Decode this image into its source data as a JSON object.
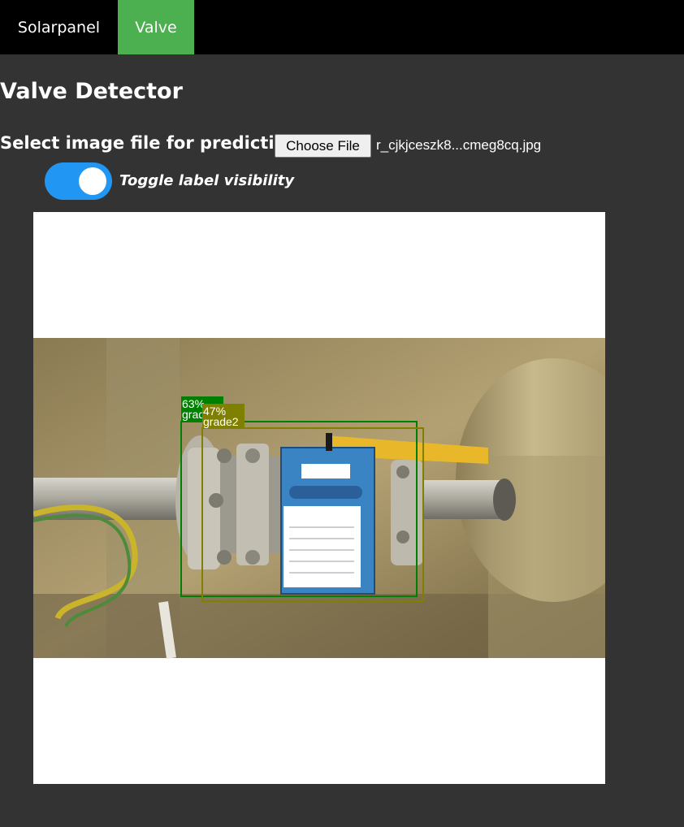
{
  "nav": {
    "tabs": [
      {
        "label": "Solarpanel",
        "active": false
      },
      {
        "label": "Valve",
        "active": true
      }
    ],
    "active_color": "#4caf50"
  },
  "page": {
    "title": "Valve Detector",
    "file_label": "Select image file for prediction:",
    "choose_button": "Choose File",
    "file_name": "r_cjkjceszk8...cmeg8cq.jpg",
    "toggle_label": "Toggle label visibility",
    "toggle_on": true,
    "toggle_color": "#2196f3"
  },
  "detections": [
    {
      "confidence": "63%",
      "label": "grade2",
      "color": "#008000"
    },
    {
      "confidence": "47%",
      "label": "grade2",
      "color": "#808000"
    }
  ]
}
